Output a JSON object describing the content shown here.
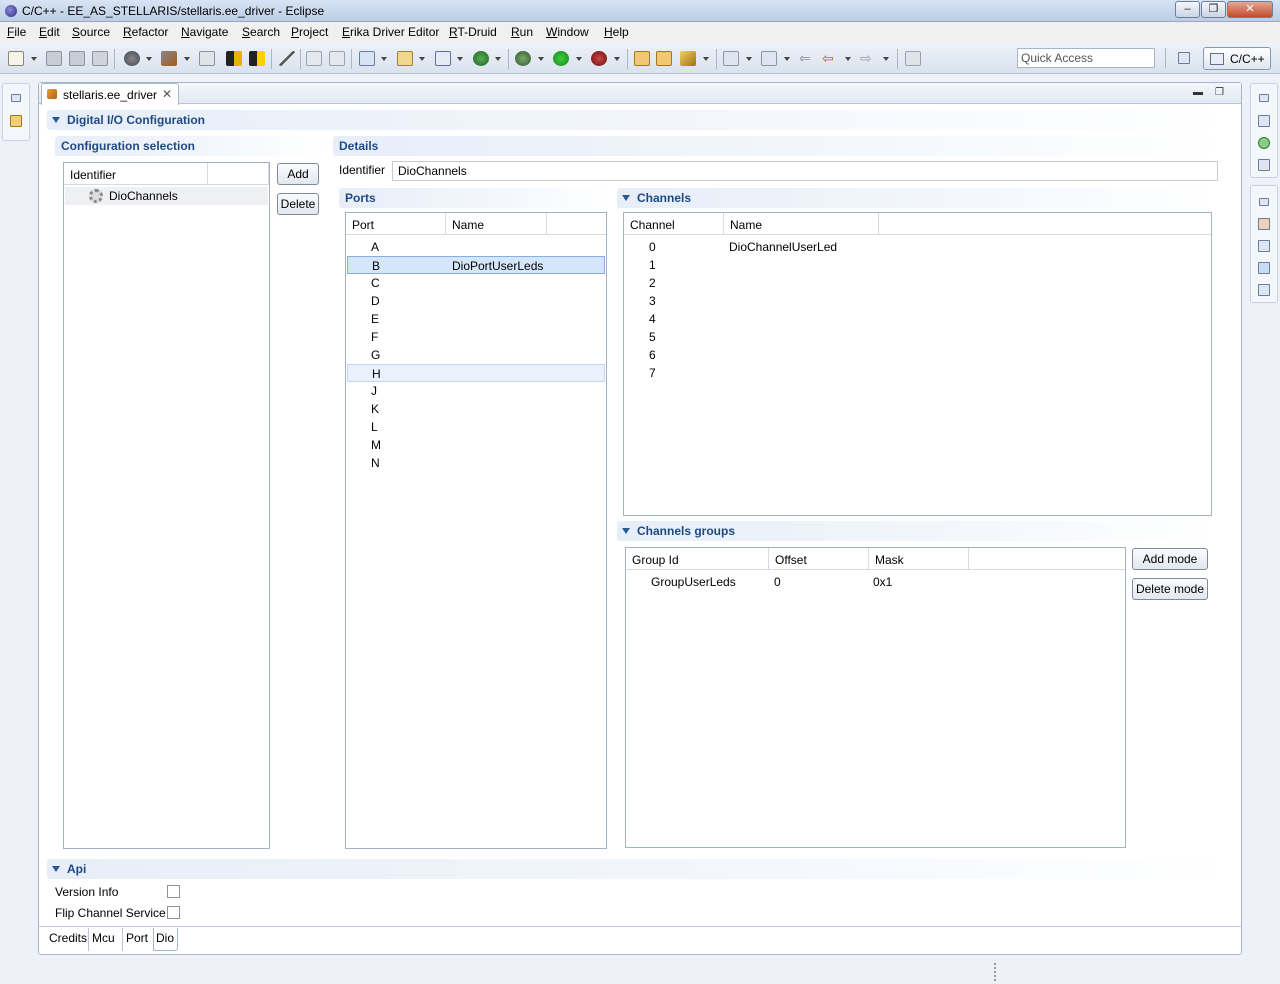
{
  "window": {
    "title": "C/C++ - EE_AS_STELLARIS/stellaris.ee_driver - Eclipse"
  },
  "menu": [
    "File",
    "Edit",
    "Source",
    "Refactor",
    "Navigate",
    "Search",
    "Project",
    "Erika Driver Editor",
    "RT-Druid",
    "Run",
    "Window",
    "Help"
  ],
  "toolbar": {
    "quick_access_placeholder": "Quick Access",
    "perspective_label": "C/C++"
  },
  "editor": {
    "tab_label": "stellaris.ee_driver",
    "main_section": "Digital I/O Configuration",
    "config_selection": {
      "title": "Configuration selection",
      "header": "Identifier",
      "items": [
        "DioChannels"
      ],
      "add_label": "Add",
      "delete_label": "Delete"
    },
    "details": {
      "title": "Details",
      "identifier_label": "Identifier",
      "identifier_value": "DioChannels"
    },
    "ports": {
      "title": "Ports",
      "columns": [
        "Port",
        "Name"
      ],
      "rows": [
        {
          "port": "A",
          "name": ""
        },
        {
          "port": "B",
          "name": "DioPortUserLeds"
        },
        {
          "port": "C",
          "name": ""
        },
        {
          "port": "D",
          "name": ""
        },
        {
          "port": "E",
          "name": ""
        },
        {
          "port": "F",
          "name": ""
        },
        {
          "port": "G",
          "name": ""
        },
        {
          "port": "H",
          "name": ""
        },
        {
          "port": "J",
          "name": ""
        },
        {
          "port": "K",
          "name": ""
        },
        {
          "port": "L",
          "name": ""
        },
        {
          "port": "M",
          "name": ""
        },
        {
          "port": "N",
          "name": ""
        }
      ],
      "selected_index": 1,
      "hover_index": 7
    },
    "channels": {
      "title": "Channels",
      "columns": [
        "Channel",
        "Name"
      ],
      "rows": [
        {
          "channel": "0",
          "name": "DioChannelUserLed"
        },
        {
          "channel": "1",
          "name": ""
        },
        {
          "channel": "2",
          "name": ""
        },
        {
          "channel": "3",
          "name": ""
        },
        {
          "channel": "4",
          "name": ""
        },
        {
          "channel": "5",
          "name": ""
        },
        {
          "channel": "6",
          "name": ""
        },
        {
          "channel": "7",
          "name": ""
        }
      ]
    },
    "channel_groups": {
      "title": "Channels groups",
      "columns": [
        "Group Id",
        "Offset",
        "Mask"
      ],
      "rows": [
        {
          "group_id": "GroupUserLeds",
          "offset": "0",
          "mask": "0x1"
        }
      ],
      "add_mode_label": "Add mode",
      "delete_mode_label": "Delete mode"
    },
    "api": {
      "title": "Api",
      "options": [
        {
          "label": "Version Info",
          "checked": false
        },
        {
          "label": "Flip Channel Service",
          "checked": false
        }
      ]
    },
    "bottom_tabs": [
      "Credits",
      "Mcu",
      "Port",
      "Dio"
    ],
    "active_bottom_tab": "Dio"
  }
}
